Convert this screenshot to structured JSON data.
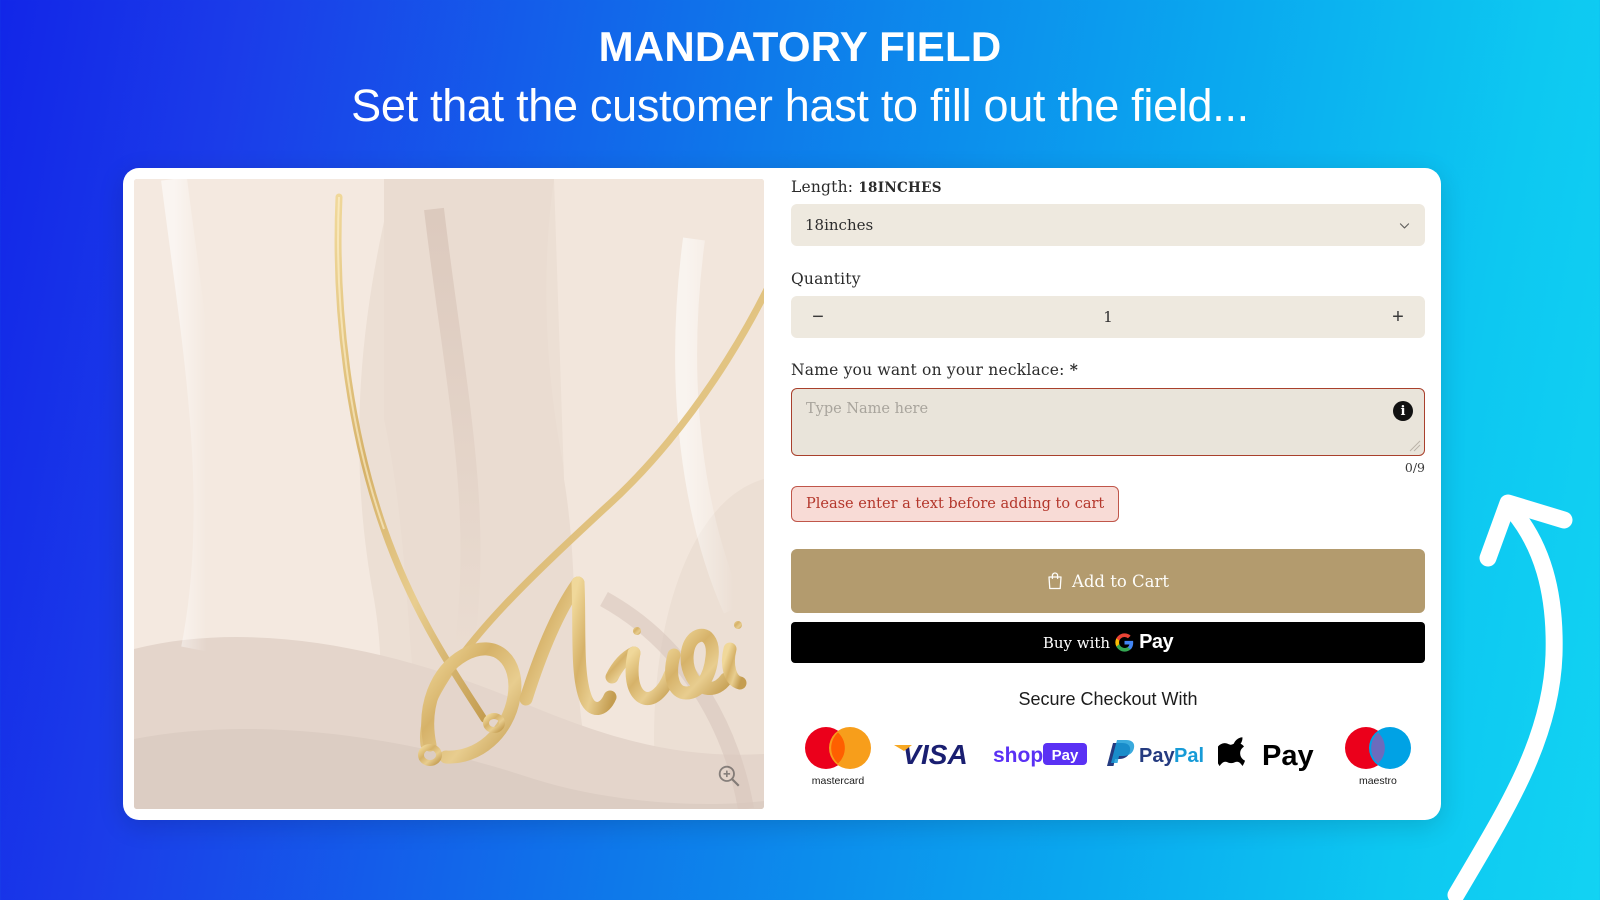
{
  "hero": {
    "title": "MANDATORY FIELD",
    "subtitle": "Set that the customer hast to fill out the field..."
  },
  "theme": {
    "gradient_start": "#1226e8",
    "gradient_end": "#12d3f3",
    "card_bg": "#ffffff",
    "field_bg": "#eee9df",
    "error_border": "#c0564a",
    "error_bg": "#f8dbd6",
    "error_text": "#b4372c",
    "cart_button_bg": "#b39b6e",
    "gpay_button_bg": "#000000"
  },
  "product_media": {
    "alt": "Gold script name necklace on beige cloth",
    "engraved_name": "Olivia",
    "zoom_icon": "magnifier-plus-icon"
  },
  "form": {
    "length": {
      "label": "Length:",
      "label_value": "18INCHES",
      "selected": "18inches",
      "options": [
        "18inches"
      ],
      "chevron_icon": "chevron-down-icon"
    },
    "quantity": {
      "label": "Quantity",
      "value": "1",
      "decrease": "−",
      "increase": "+"
    },
    "personalization": {
      "label": "Name you want on your necklace:",
      "required_marker": "*",
      "placeholder": "Type Name here",
      "value": "",
      "counter": "0/9",
      "info_icon": "info-icon",
      "info_glyph": "i",
      "error_message": "Please enter a text before adding to cart"
    }
  },
  "actions": {
    "add_to_cart": "Add to Cart",
    "cart_icon": "shopping-bag-icon",
    "gpay_prefix": "Buy with",
    "gpay_label": "Pay",
    "gpay_icon": "google-g-icon"
  },
  "checkout": {
    "title": "Secure Checkout With",
    "methods": [
      {
        "name": "mastercard",
        "caption": "mastercard",
        "icon": "mastercard-icon"
      },
      {
        "name": "visa",
        "caption": "",
        "icon": "visa-icon"
      },
      {
        "name": "shop-pay",
        "caption": "",
        "icon": "shop-pay-icon"
      },
      {
        "name": "paypal",
        "caption": "",
        "icon": "paypal-icon"
      },
      {
        "name": "apple-pay",
        "caption": "",
        "icon": "apple-pay-icon"
      },
      {
        "name": "maestro",
        "caption": "maestro",
        "icon": "maestro-icon"
      }
    ]
  },
  "annotation": {
    "arrow_icon": "curved-arrow-up-left-icon"
  }
}
